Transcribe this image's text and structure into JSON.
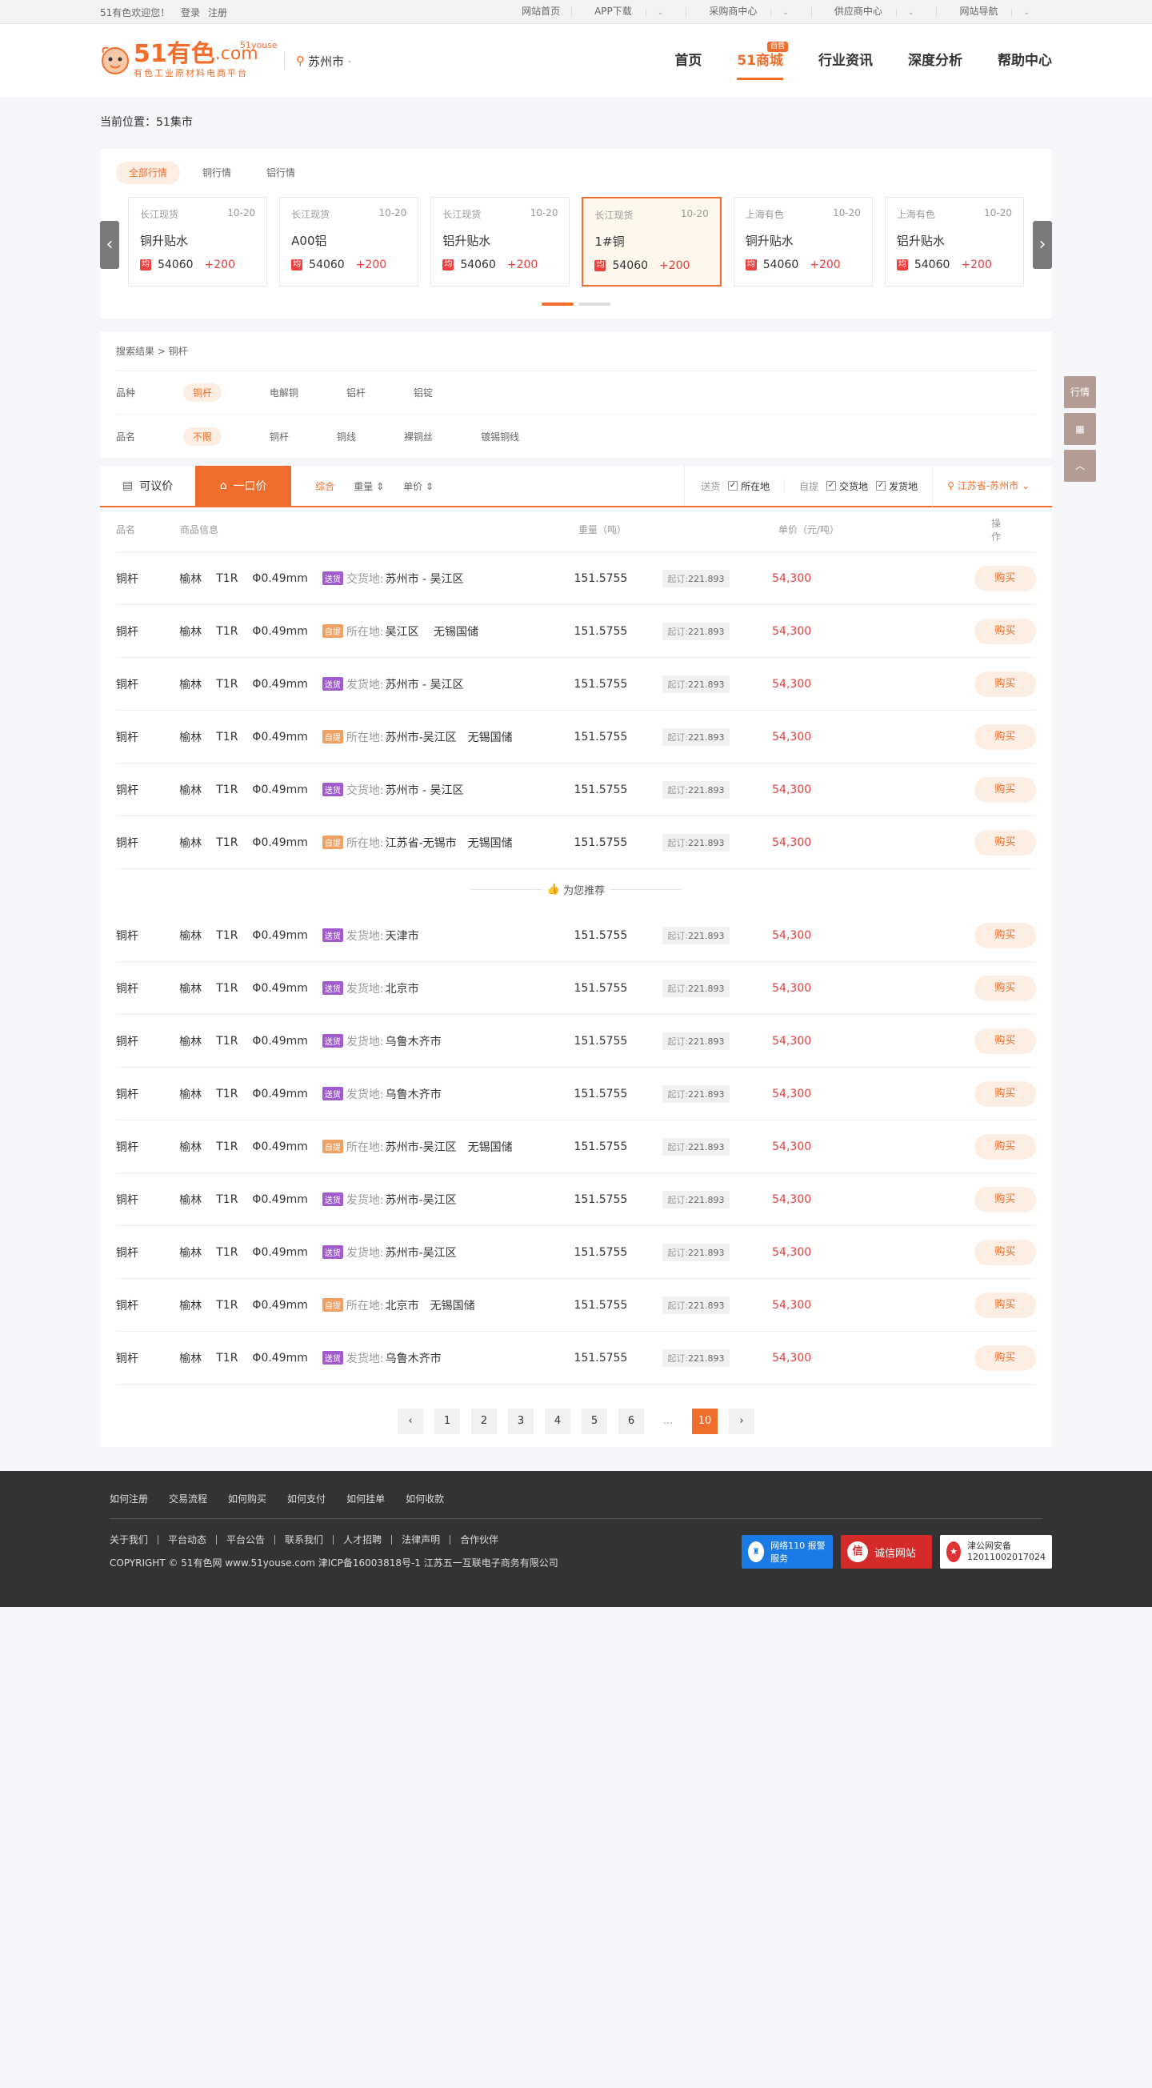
{
  "topbar": {
    "welcome": "51有色欢迎您！",
    "login": "登录",
    "register": "注册",
    "links": [
      "网站首页",
      "APP下载",
      "采购商中心",
      "供应商中心",
      "网站导航"
    ]
  },
  "header": {
    "logo_main": "51有色",
    "logo_dot": ".com",
    "logo_tag": "51youse",
    "logo_sub": "有色工业原材料电商平台",
    "city": "苏州市",
    "nav": [
      "首页",
      "51商城",
      "行业资讯",
      "深度分析",
      "帮助中心"
    ],
    "nav_badge": "自营"
  },
  "breadcrumb": "当前位置：51集市",
  "market": {
    "tabs": [
      "全部行情",
      "铜行情",
      "铝行情"
    ],
    "cards": [
      {
        "source": "长江现货",
        "date": "10-20",
        "name": "铜升贴水",
        "icon": "均",
        "price": "54060",
        "change": "+200"
      },
      {
        "source": "长江现货",
        "date": "10-20",
        "name": "A00铝",
        "icon": "均",
        "price": "54060",
        "change": "+200"
      },
      {
        "source": "长江现货",
        "date": "10-20",
        "name": "铝升贴水",
        "icon": "均",
        "price": "54060",
        "change": "+200"
      },
      {
        "source": "长江现货",
        "date": "10-20",
        "name": "1#铜",
        "icon": "均",
        "price": "54060",
        "change": "+200"
      },
      {
        "source": "上海有色",
        "date": "10-20",
        "name": "铜升贴水",
        "icon": "均",
        "price": "54060",
        "change": "+200"
      },
      {
        "source": "上海有色",
        "date": "10-20",
        "name": "铝升贴水",
        "icon": "均",
        "price": "54060",
        "change": "+200"
      }
    ]
  },
  "filter": {
    "crumb": "搜索结果 > 铜杆",
    "variety_label": "品种",
    "varieties": [
      "铜杆",
      "电解铜",
      "铝杆",
      "铝锭"
    ],
    "name_label": "品名",
    "names": [
      "不限",
      "铜杆",
      "铜线",
      "裸铜丝",
      "镀锡铜线"
    ]
  },
  "toolbar": {
    "tab1": "可议价",
    "tab2": "一口价",
    "sorts": [
      "综合",
      "重量 ⇕",
      "单价 ⇕"
    ],
    "send_label": "送货",
    "send_check": "所在地",
    "self_label": "自提",
    "self_check1": "交货地",
    "self_check2": "发货地",
    "region": "江苏省-苏州市"
  },
  "table": {
    "headers": [
      "品名",
      "商品信息",
      "重量（吨）",
      "单价（元/吨）",
      "操作"
    ],
    "rows": [
      {
        "name": "铜杆",
        "brand": "榆林",
        "grade": "T1R",
        "size": "Φ0.49mm",
        "tag": "送货",
        "loc_label": "交货地:",
        "loc": "苏州市 - 吴江区",
        "weight": "151.5755",
        "min_label": "起订:",
        "min": "221.893",
        "price": "54,300",
        "buy": "购买"
      },
      {
        "name": "铜杆",
        "brand": "榆林",
        "grade": "T1R",
        "size": "Φ0.49mm",
        "tag": "自提",
        "loc_label": "所在地:",
        "loc": "吴江区　 无锡国储",
        "weight": "151.5755",
        "min_label": "起订:",
        "min": "221.893",
        "price": "54,300",
        "buy": "购买"
      },
      {
        "name": "铜杆",
        "brand": "榆林",
        "grade": "T1R",
        "size": "Φ0.49mm",
        "tag": "送货",
        "loc_label": "发货地:",
        "loc": "苏州市 - 吴江区",
        "weight": "151.5755",
        "min_label": "起订:",
        "min": "221.893",
        "price": "54,300",
        "buy": "购买"
      },
      {
        "name": "铜杆",
        "brand": "榆林",
        "grade": "T1R",
        "size": "Φ0.49mm",
        "tag": "自提",
        "loc_label": "所在地:",
        "loc": "苏州市-吴江区　无锡国储",
        "weight": "151.5755",
        "min_label": "起订:",
        "min": "221.893",
        "price": "54,300",
        "buy": "购买"
      },
      {
        "name": "铜杆",
        "brand": "榆林",
        "grade": "T1R",
        "size": "Φ0.49mm",
        "tag": "送货",
        "loc_label": "交货地:",
        "loc": "苏州市 - 吴江区",
        "weight": "151.5755",
        "min_label": "起订:",
        "min": "221.893",
        "price": "54,300",
        "buy": "购买"
      },
      {
        "name": "铜杆",
        "brand": "榆林",
        "grade": "T1R",
        "size": "Φ0.49mm",
        "tag": "自提",
        "loc_label": "所在地:",
        "loc": "江苏省-无锡市　无锡国储",
        "weight": "151.5755",
        "min_label": "起订:",
        "min": "221.893",
        "price": "54,300",
        "buy": "购买"
      }
    ],
    "recommend_label": "为您推荐",
    "rec_rows": [
      {
        "name": "铜杆",
        "brand": "榆林",
        "grade": "T1R",
        "size": "Φ0.49mm",
        "tag": "送货",
        "loc_label": "发货地:",
        "loc": "天津市",
        "weight": "151.5755",
        "min_label": "起订:",
        "min": "221.893",
        "price": "54,300",
        "buy": "购买"
      },
      {
        "name": "铜杆",
        "brand": "榆林",
        "grade": "T1R",
        "size": "Φ0.49mm",
        "tag": "送货",
        "loc_label": "发货地:",
        "loc": "北京市",
        "weight": "151.5755",
        "min_label": "起订:",
        "min": "221.893",
        "price": "54,300",
        "buy": "购买"
      },
      {
        "name": "铜杆",
        "brand": "榆林",
        "grade": "T1R",
        "size": "Φ0.49mm",
        "tag": "送货",
        "loc_label": "发货地:",
        "loc": "乌鲁木齐市",
        "weight": "151.5755",
        "min_label": "起订:",
        "min": "221.893",
        "price": "54,300",
        "buy": "购买"
      },
      {
        "name": "铜杆",
        "brand": "榆林",
        "grade": "T1R",
        "size": "Φ0.49mm",
        "tag": "送货",
        "loc_label": "发货地:",
        "loc": "乌鲁木齐市",
        "weight": "151.5755",
        "min_label": "起订:",
        "min": "221.893",
        "price": "54,300",
        "buy": "购买"
      },
      {
        "name": "铜杆",
        "brand": "榆林",
        "grade": "T1R",
        "size": "Φ0.49mm",
        "tag": "自提",
        "loc_label": "所在地:",
        "loc": "苏州市-吴江区　无锡国储",
        "weight": "151.5755",
        "min_label": "起订:",
        "min": "221.893",
        "price": "54,300",
        "buy": "购买"
      },
      {
        "name": "铜杆",
        "brand": "榆林",
        "grade": "T1R",
        "size": "Φ0.49mm",
        "tag": "送货",
        "loc_label": "发货地:",
        "loc": "苏州市-吴江区",
        "weight": "151.5755",
        "min_label": "起订:",
        "min": "221.893",
        "price": "54,300",
        "buy": "购买"
      },
      {
        "name": "铜杆",
        "brand": "榆林",
        "grade": "T1R",
        "size": "Φ0.49mm",
        "tag": "送货",
        "loc_label": "发货地:",
        "loc": "苏州市-吴江区",
        "weight": "151.5755",
        "min_label": "起订:",
        "min": "221.893",
        "price": "54,300",
        "buy": "购买"
      },
      {
        "name": "铜杆",
        "brand": "榆林",
        "grade": "T1R",
        "size": "Φ0.49mm",
        "tag": "自提",
        "loc_label": "所在地:",
        "loc": "北京市　无锡国储",
        "weight": "151.5755",
        "min_label": "起订:",
        "min": "221.893",
        "price": "54,300",
        "buy": "购买"
      },
      {
        "name": "铜杆",
        "brand": "榆林",
        "grade": "T1R",
        "size": "Φ0.49mm",
        "tag": "送货",
        "loc_label": "发货地:",
        "loc": "乌鲁木齐市",
        "weight": "151.5755",
        "min_label": "起订:",
        "min": "221.893",
        "price": "54,300",
        "buy": "购买"
      }
    ]
  },
  "pager": {
    "prev": "‹",
    "pages": [
      "1",
      "2",
      "3",
      "4",
      "5",
      "6"
    ],
    "ellipsis": "...",
    "current": "10",
    "next": "›"
  },
  "side": {
    "market": "行情",
    "qr_icon": "qrcode-icon",
    "top_icon": "chevron-up-icon"
  },
  "footer": {
    "links1": [
      "如何注册",
      "交易流程",
      "如何购买",
      "如何支付",
      "如何挂单",
      "如何收款"
    ],
    "links2": [
      "关于我们",
      "平台动态",
      "平台公告",
      "联系我们",
      "人才招聘",
      "法律声明",
      "合作伙伴"
    ],
    "copyright": "COPYRIGHT © 51有色网  www.51youse.com  津ICP备16003818号-1  江苏五一互联电子商务有限公司",
    "badge1": "网络110 报警服务",
    "badge2": "诚信网站",
    "badge2_icon": "信",
    "badge3_line1": "津公网安备",
    "badge3_line2": "12011002017024"
  },
  "colors": {
    "accent": "#f06d2b",
    "price_red": "#e53b3b",
    "tag_send": "#a05ccf",
    "tag_self": "#f0a060",
    "footer_bg": "#333333"
  }
}
